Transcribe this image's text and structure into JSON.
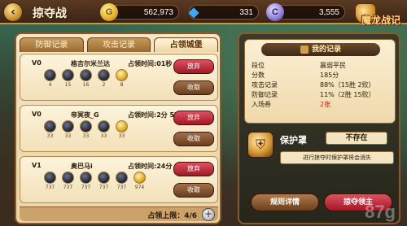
{
  "header": {
    "title": "掠夺战",
    "back_icon": "back-arrow-icon",
    "resources": {
      "gold": "562,973",
      "gems": "331",
      "honor": "3,555"
    },
    "logo_text": "魔龙战记"
  },
  "tabs": [
    "防御记录",
    "攻击记录",
    "占领城堡"
  ],
  "active_tab": 2,
  "occupied": [
    {
      "rank": "V0",
      "name": "格吉尔米兰达",
      "time_label": "占领时间:01秒",
      "troops": [
        "4",
        "15",
        "16",
        "2",
        "8"
      ],
      "abandon": "放弃",
      "collect": "收取"
    },
    {
      "rank": "V0",
      "name": "帝冥夜_G",
      "time_label": "占领时间:2分 57秒",
      "troops": [
        "33",
        "33",
        "33",
        "33",
        "33"
      ],
      "abandon": "放弃",
      "collect": "收取"
    },
    {
      "rank": "V1",
      "name": "奥巴马i",
      "time_label": "占领时间:24分 01秒",
      "troops": [
        "737",
        "737",
        "737",
        "737",
        "737",
        "974"
      ],
      "abandon": "放弃",
      "collect": "收取"
    }
  ],
  "occupy_limit": "占领上限：4/6",
  "my_record": {
    "title": "我的记录",
    "rows": [
      {
        "label": "段位",
        "value": "羸弱平民",
        "color": "default"
      },
      {
        "label": "分数",
        "value": "185分",
        "color": "default"
      },
      {
        "label": "攻击记录",
        "value": "88%（15胜 2败）",
        "color": "default"
      },
      {
        "label": "防御记录",
        "value": "11%（2胜 15败）",
        "color": "default"
      },
      {
        "label": "入场券",
        "value": "2张",
        "color": "red"
      }
    ]
  },
  "protect": {
    "title": "保护罩",
    "status": "不存在",
    "note": "进行掠夺时保护罩将会消失"
  },
  "buttons": {
    "rules": "规则详情",
    "plunder": "掠夺领主"
  },
  "watermark": "87g"
}
